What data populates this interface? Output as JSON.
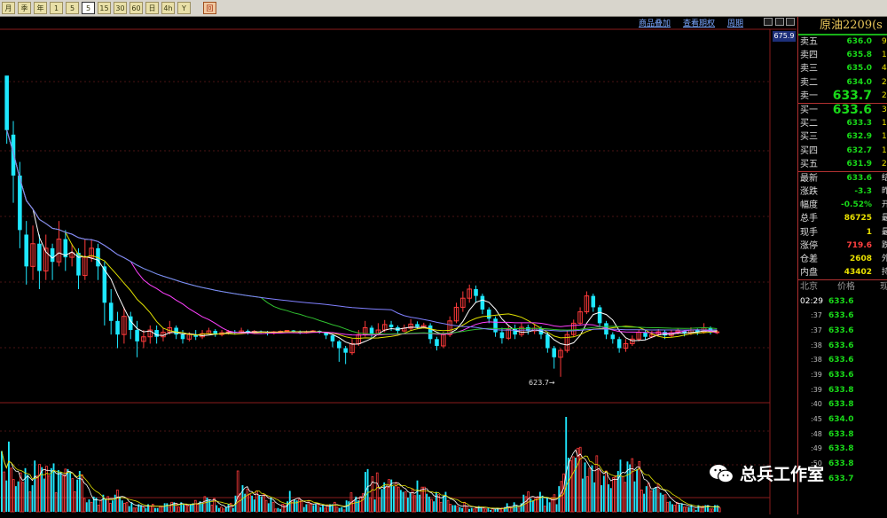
{
  "toolbar": {
    "buttons": [
      "月",
      "季",
      "年",
      "1",
      "5",
      "5",
      "15",
      "30",
      "60",
      "日",
      "4h",
      "Y",
      "回"
    ],
    "selected": 5
  },
  "links": [
    "商品叠加",
    "查看期权",
    "周期"
  ],
  "price_tag": "675.9",
  "low_label": "623.7→",
  "colors": {
    "up": "#ff3a3a",
    "down": "#1ee8ff",
    "ma5": "#ffffff",
    "ma10": "#e0e000",
    "ma20": "#ff40ff",
    "ma40": "#30c030",
    "ma60": "#8080ff"
  },
  "panel": {
    "title": "原油2209(s",
    "asks": [
      {
        "label": "卖五",
        "price": "636.0",
        "qty": "9"
      },
      {
        "label": "卖四",
        "price": "635.8",
        "qty": "1"
      },
      {
        "label": "卖三",
        "price": "635.0",
        "qty": "4"
      },
      {
        "label": "卖二",
        "price": "634.0",
        "qty": "2"
      }
    ],
    "ask1": {
      "label": "卖一",
      "price": "633.7",
      "qty": "2"
    },
    "bid1": {
      "label": "买一",
      "price": "633.6",
      "qty": "3"
    },
    "bids": [
      {
        "label": "买二",
        "price": "633.3",
        "qty": "1"
      },
      {
        "label": "买三",
        "price": "632.9",
        "qty": "1"
      },
      {
        "label": "买四",
        "price": "632.7",
        "qty": "1"
      },
      {
        "label": "买五",
        "price": "631.9",
        "qty": "2"
      }
    ],
    "stats": [
      {
        "label": "最新",
        "value": "633.6",
        "extra": "结"
      },
      {
        "label": "涨跌",
        "value": "-3.3",
        "extra": "昨"
      },
      {
        "label": "幅度",
        "value": "-0.52%",
        "extra": "开"
      },
      {
        "label": "总手",
        "value": "86725",
        "extra": "最"
      },
      {
        "label": "现手",
        "value": "1",
        "extra": "最"
      },
      {
        "label": "涨停",
        "value": "719.6",
        "extra": "跌"
      },
      {
        "label": "仓差",
        "value": "2608",
        "extra": "外"
      },
      {
        "label": "内盘",
        "value": "43402",
        "extra": "持"
      }
    ],
    "tick_header": {
      "col1": "北京",
      "col2": "价格",
      "col3": "现"
    },
    "ticks": [
      {
        "time": "02:29",
        "price": "633.6"
      },
      {
        "time": ":37",
        "price": "633.6"
      },
      {
        "time": ":37",
        "price": "633.6"
      },
      {
        "time": ":38",
        "price": "633.6"
      },
      {
        "time": ":38",
        "price": "633.6"
      },
      {
        "time": ":39",
        "price": "633.6"
      },
      {
        "time": ":39",
        "price": "633.8"
      },
      {
        "time": ":40",
        "price": "633.8"
      },
      {
        "time": ":45",
        "price": "634.0"
      },
      {
        "time": ":48",
        "price": "633.8"
      },
      {
        "time": ":49",
        "price": "633.8"
      },
      {
        "time": ":50",
        "price": "633.8"
      },
      {
        "time": ":51",
        "price": "633.7"
      }
    ]
  },
  "watermark": "总兵工作室",
  "chart_data": {
    "type": "candlestick",
    "candles": [
      [
        690.0,
        678.0,
        689.0,
        675.0
      ],
      [
        677.0,
        668.0,
        680.0,
        662.0
      ],
      [
        668.0,
        656.0,
        671.0,
        652.0
      ],
      [
        655.0,
        648.0,
        658.0,
        644.0
      ],
      [
        648.0,
        653.0,
        657.0,
        645.0
      ],
      [
        653.0,
        647.0,
        655.0,
        643.0
      ],
      [
        647.0,
        652.0,
        655.0,
        645.0
      ],
      [
        652.0,
        649.0,
        653.0,
        645.0
      ],
      [
        649.0,
        654.0,
        658.0,
        648.0
      ],
      [
        654.0,
        650.0,
        656.0,
        647.0
      ],
      [
        650.0,
        651.0,
        653.0,
        648.0
      ],
      [
        651.0,
        646.0,
        652.0,
        643.0
      ],
      [
        646.0,
        650.0,
        654.0,
        645.0
      ],
      [
        650.0,
        652.0,
        654.0,
        649.0
      ],
      [
        652.0,
        648.0,
        653.0,
        645.0
      ],
      [
        648.0,
        640.0,
        649.0,
        635.0
      ],
      [
        640.0,
        636.0,
        643.0,
        633.0
      ],
      [
        636.0,
        633.0,
        638.0,
        630.0
      ],
      [
        633.0,
        637.0,
        639.0,
        631.0
      ],
      [
        637.0,
        634.0,
        638.0,
        632.0
      ],
      [
        634.0,
        631.5,
        636.0,
        628.0
      ],
      [
        631.5,
        632.5,
        634.0,
        630.0
      ],
      [
        632.5,
        634.0,
        635.0,
        631.0
      ],
      [
        634.0,
        632.5,
        635.0,
        631.0
      ],
      [
        632.5,
        633.5,
        634.5,
        631.5
      ],
      [
        633.5,
        634.5,
        636.0,
        633.0
      ],
      [
        634.5,
        633.0,
        635.0,
        632.0
      ],
      [
        633.0,
        632.0,
        634.0,
        631.0
      ],
      [
        632.0,
        633.0,
        633.5,
        631.5
      ],
      [
        633.0,
        632.5,
        634.0,
        631.8
      ],
      [
        632.5,
        633.2,
        634.0,
        632.0
      ],
      [
        633.2,
        633.8,
        634.5,
        633.0
      ],
      [
        633.8,
        633.0,
        634.2,
        632.5
      ],
      [
        633.0,
        633.4,
        634.0,
        632.6
      ],
      [
        633.4,
        633.6,
        634.0,
        633.0
      ],
      [
        633.6,
        633.5,
        634.0,
        633.0
      ],
      [
        633.5,
        633.8,
        634.5,
        633.2
      ],
      [
        633.8,
        633.4,
        634.1,
        633.0
      ],
      [
        633.4,
        633.7,
        634.0,
        633.1
      ],
      [
        633.7,
        633.6,
        633.9,
        633.3
      ],
      [
        633.6,
        633.3,
        633.8,
        632.8
      ],
      [
        633.3,
        633.6,
        633.8,
        633.0
      ],
      [
        633.6,
        633.7,
        633.9,
        633.4
      ],
      [
        633.7,
        633.9,
        634.0,
        633.5
      ],
      [
        633.9,
        633.6,
        634.0,
        633.3
      ],
      [
        633.6,
        633.4,
        633.9,
        633.1
      ],
      [
        633.4,
        633.6,
        633.9,
        633.2
      ],
      [
        633.6,
        633.8,
        634.0,
        633.5
      ],
      [
        633.8,
        633.5,
        633.9,
        633.2
      ],
      [
        633.5,
        632.8,
        633.6,
        632.0
      ],
      [
        632.8,
        631.5,
        633.0,
        630.2
      ],
      [
        631.5,
        630.0,
        631.8,
        627.0
      ],
      [
        630.0,
        629.0,
        630.5,
        626.5
      ],
      [
        629.0,
        631.0,
        632.0,
        628.5
      ],
      [
        631.0,
        633.0,
        634.0,
        630.5
      ],
      [
        633.0,
        634.5,
        636.0,
        632.5
      ],
      [
        634.5,
        633.2,
        635.0,
        632.0
      ],
      [
        633.2,
        634.0,
        635.5,
        632.8
      ],
      [
        634.0,
        635.2,
        636.2,
        633.5
      ],
      [
        635.2,
        634.6,
        636.0,
        633.8
      ],
      [
        634.6,
        633.8,
        635.0,
        633.0
      ],
      [
        633.8,
        634.4,
        635.2,
        633.5
      ],
      [
        634.4,
        635.3,
        636.4,
        634.0
      ],
      [
        635.3,
        634.7,
        635.9,
        634.2
      ],
      [
        634.7,
        635.0,
        635.6,
        634.3
      ],
      [
        635.0,
        632.0,
        635.5,
        631.0
      ],
      [
        632.0,
        630.5,
        632.5,
        629.5
      ],
      [
        630.5,
        633.0,
        633.6,
        630.0
      ],
      [
        633.0,
        636.0,
        637.0,
        632.5
      ],
      [
        636.0,
        639.0,
        640.0,
        635.5
      ],
      [
        639.0,
        641.0,
        642.5,
        638.0
      ],
      [
        641.0,
        643.0,
        644.0,
        640.0
      ],
      [
        643.0,
        641.5,
        643.8,
        640.0
      ],
      [
        641.5,
        638.5,
        642.0,
        637.5
      ],
      [
        638.5,
        636.5,
        639.0,
        635.5
      ],
      [
        636.5,
        633.5,
        637.0,
        632.5
      ],
      [
        633.5,
        632.2,
        634.5,
        631.0
      ],
      [
        632.2,
        634.2,
        635.0,
        631.8
      ],
      [
        634.2,
        633.0,
        635.2,
        632.0
      ],
      [
        633.0,
        634.6,
        635.5,
        632.5
      ],
      [
        634.6,
        633.8,
        635.2,
        633.0
      ],
      [
        633.8,
        634.4,
        635.3,
        633.1
      ],
      [
        634.4,
        633.0,
        634.8,
        632.0
      ],
      [
        633.0,
        630.0,
        633.5,
        629.0
      ],
      [
        630.0,
        628.0,
        630.5,
        625.5
      ],
      [
        628.0,
        629.5,
        630.0,
        623.7
      ],
      [
        629.5,
        633.0,
        634.0,
        629.0
      ],
      [
        633.0,
        635.5,
        636.3,
        632.5
      ],
      [
        635.5,
        638.0,
        639.0,
        635.0
      ],
      [
        638.0,
        641.5,
        642.5,
        637.5
      ],
      [
        641.5,
        639.0,
        642.0,
        638.0
      ],
      [
        639.0,
        635.5,
        639.5,
        634.5
      ],
      [
        635.5,
        633.0,
        636.0,
        632.0
      ],
      [
        633.0,
        632.0,
        633.5,
        631.0
      ],
      [
        632.0,
        630.0,
        632.5,
        629.0
      ],
      [
        630.0,
        631.0,
        632.0,
        629.2
      ],
      [
        631.0,
        632.0,
        632.8,
        630.5
      ],
      [
        632.0,
        633.5,
        634.0,
        631.5
      ],
      [
        633.5,
        632.5,
        634.0,
        631.8
      ],
      [
        632.5,
        633.0,
        633.8,
        632.2
      ],
      [
        633.0,
        633.6,
        634.2,
        632.6
      ],
      [
        633.6,
        632.8,
        634.0,
        632.0
      ],
      [
        632.8,
        633.4,
        634.0,
        632.4
      ],
      [
        633.4,
        633.8,
        634.4,
        633.0
      ],
      [
        633.8,
        633.2,
        634.0,
        632.6
      ],
      [
        633.2,
        634.0,
        634.6,
        632.9
      ],
      [
        634.0,
        633.5,
        634.3,
        632.9
      ],
      [
        633.5,
        634.5,
        635.5,
        633.2
      ],
      [
        634.5,
        633.5,
        634.8,
        633.0
      ],
      [
        633.5,
        633.6,
        634.0,
        633.1
      ]
    ],
    "ylim": [
      618,
      700
    ],
    "volume": [
      0.64,
      0.42,
      0.33,
      0.74,
      0.46,
      0.34,
      0.27,
      0.32,
      0.41,
      0.31,
      0.46,
      0.39,
      0.21,
      0.28,
      0.54,
      0.38,
      0.5,
      0.47,
      0.35,
      0.48,
      0.38,
      0.46,
      0.51,
      0.2,
      0.44,
      0.42,
      0.38,
      0.45,
      0.45,
      0.42,
      0.35,
      0.21,
      0.34,
      0.43,
      0.39,
      0.14,
      0.1,
      0.13,
      0.1,
      0.16,
      0.15,
      0.07,
      0.12,
      0.18,
      0.14,
      0.16,
      0.09,
      0.12,
      0.18,
      0.23,
      0.16,
      0.12,
      0.09,
      0.1,
      0.06,
      0.1,
      0.04,
      0.04,
      0.08,
      0.07,
      0.05,
      0.04,
      0.08,
      0.06,
      0.08,
      0.04,
      0.04,
      0.06,
      0.06,
      0.09,
      0.09,
      0.05,
      0.1,
      0.1,
      0.09,
      0.05,
      0.1,
      0.08,
      0.07,
      0.06,
      0.08,
      0.09,
      0.12,
      0.08,
      0.11,
      0.09,
      0.16,
      0.15,
      0.13,
      0.07,
      0.14,
      0.07,
      0.04,
      0.05,
      0.03,
      0.05,
      0.08,
      0.09,
      0.04,
      0.17,
      0.43,
      0.19,
      0.28,
      0.19,
      0.24,
      0.18,
      0.17,
      0.13,
      0.22,
      0.17,
      0.16,
      0.18,
      0.12,
      0.09,
      0.15,
      0.1,
      0.03,
      0.04,
      0.03,
      0.08,
      0.07,
      0.11,
      0.22,
      0.12,
      0.13,
      0.12,
      0.13,
      0.11,
      0.05,
      0.08,
      0.12,
      0.08,
      0.07,
      0.08,
      0.08,
      0.05,
      0.07,
      0.04,
      0.07,
      0.08,
      0.08,
      0.1,
      0.05,
      0.04,
      0.05,
      0.02,
      0.12,
      0.11,
      0.2,
      0.12,
      0.16,
      0.12,
      0.16,
      0.19,
      0.42,
      0.45,
      0.15,
      0.37,
      0.13,
      0.41,
      0.15,
      0.24,
      0.31,
      0.26,
      0.34,
      0.34,
      0.27,
      0.31,
      0.26,
      0.23,
      0.21,
      0.21,
      0.15,
      0.2,
      0.24,
      0.17,
      0.33,
      0.18,
      0.26,
      0.26,
      0.19,
      0.16,
      0.13,
      0.11,
      0.21,
      0.18,
      0.1,
      0.17,
      0.21,
      0.12,
      0.08,
      0.07,
      0.07,
      0.06,
      0.05,
      0.04,
      0.1,
      0.06,
      0.03,
      0.04,
      0.03,
      0.05,
      0.06,
      0.05,
      0.04,
      0.03,
      0.04,
      0.02,
      0.03,
      0.03,
      0.04,
      0.03,
      0.04,
      0.05,
      0.09,
      0.05,
      0.04,
      0.1,
      0.07,
      0.04,
      0.09,
      0.18,
      0.16,
      0.21,
      0.14,
      0.12,
      0.14,
      0.16,
      0.21,
      0.17,
      0.06,
      0.15,
      0.1,
      0.15,
      0.18,
      0.08,
      0.27,
      0.32,
      0.4,
      1.0,
      0.57,
      0.54,
      0.58,
      0.57,
      0.67,
      0.68,
      0.35,
      0.52,
      0.37,
      0.46,
      0.49,
      0.31,
      0.59,
      0.44,
      0.28,
      0.38,
      0.43,
      0.29,
      0.25,
      0.36,
      0.38,
      0.43,
      0.55,
      0.37,
      0.31,
      0.53,
      0.5,
      0.56,
      0.32,
      0.45,
      0.53,
      0.23,
      0.19,
      0.27,
      0.3,
      0.22,
      0.24,
      0.26,
      0.29,
      0.2,
      0.18,
      0.18,
      0.1,
      0.11,
      0.08,
      0.07,
      0.1,
      0.08,
      0.09,
      0.05,
      0.05,
      0.05,
      0.07,
      0.03,
      0.02,
      0.07,
      0.05,
      0.06,
      0.07,
      0.07,
      0.03,
      0.03,
      0.07,
      0.07,
      0.04
    ]
  }
}
